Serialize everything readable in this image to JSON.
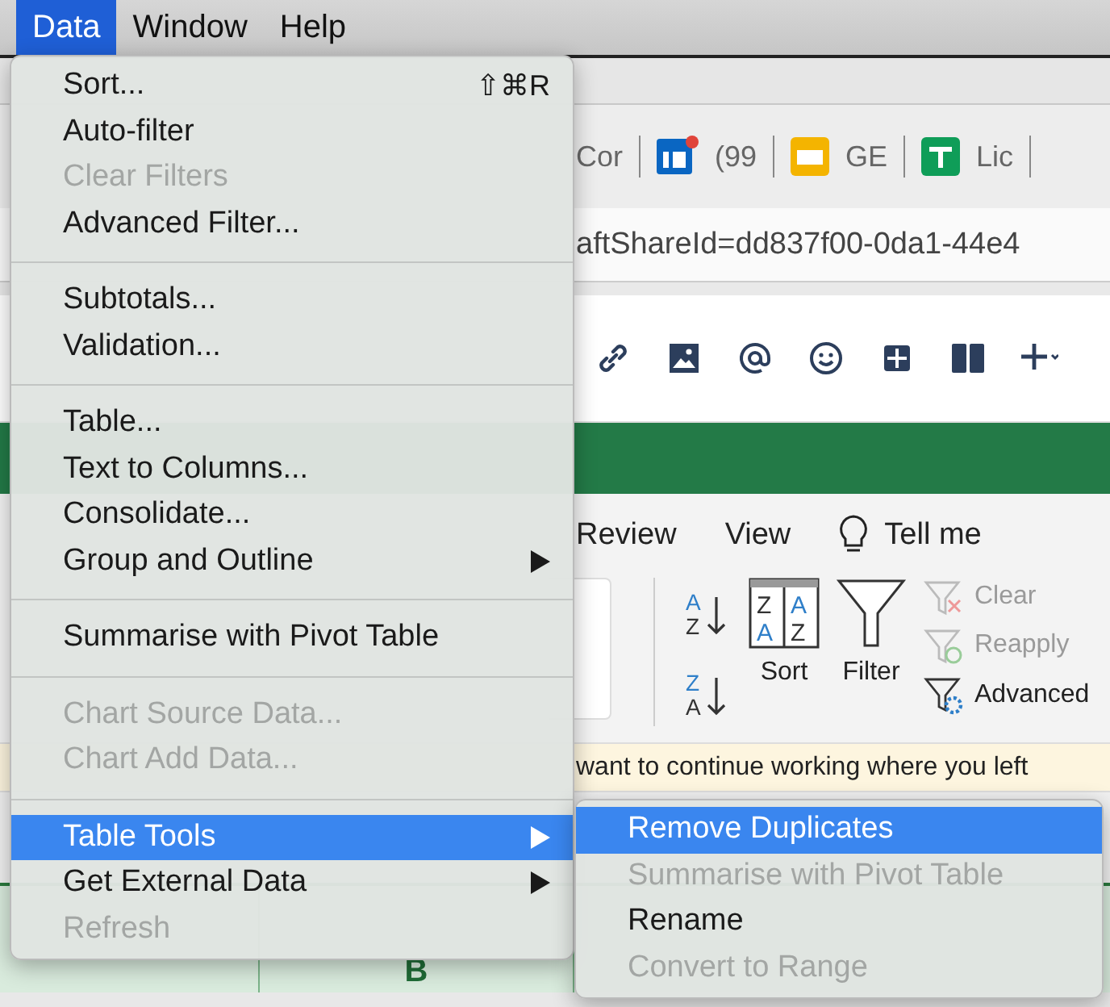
{
  "menubar": [
    {
      "label": "Data",
      "selected": true
    },
    {
      "label": "Window",
      "selected": false
    },
    {
      "label": "Help",
      "selected": false
    }
  ],
  "browser": {
    "bookmarks": [
      {
        "label": "Cor",
        "kind": "plain"
      },
      {
        "label": "(99",
        "kind": "profile"
      },
      {
        "label": "GE",
        "kind": "slides"
      },
      {
        "label": "Lic",
        "kind": "sheet"
      }
    ],
    "address": "aftShareId=dd837f00-0da1-44e4"
  },
  "ribbon": {
    "tabs": [
      {
        "label": "Review",
        "kind": "tab"
      },
      {
        "label": "View",
        "kind": "tab"
      },
      {
        "label": "Tell me",
        "kind": "search"
      }
    ],
    "sort_icons": [
      {
        "letters": [
          "A",
          "Z"
        ]
      },
      {
        "letters": [
          "Z",
          "A"
        ]
      }
    ],
    "sort_dialog_letters": [
      "Z",
      "A",
      "A",
      "Z"
    ],
    "sort_label": "Sort",
    "filter_label": "Filter",
    "filter_actions": [
      {
        "label": "Clear",
        "disabled": true,
        "kind": "clear"
      },
      {
        "label": "Reapply",
        "disabled": true,
        "kind": "reapply"
      },
      {
        "label": "Advanced",
        "disabled": false,
        "kind": "advanced"
      }
    ]
  },
  "notification": "want to continue working where you left",
  "sheet": {
    "column_header": "B"
  },
  "menu": {
    "items": [
      {
        "kind": "item",
        "label": "Sort...",
        "shortcut": "⇧⌘R",
        "disabled": false,
        "selected": false,
        "submenu": false
      },
      {
        "kind": "item",
        "label": "Auto-filter",
        "disabled": false,
        "selected": false,
        "submenu": false
      },
      {
        "kind": "item",
        "label": "Clear Filters",
        "disabled": true,
        "selected": false,
        "submenu": false
      },
      {
        "kind": "item",
        "label": "Advanced Filter...",
        "disabled": false,
        "selected": false,
        "submenu": false
      },
      {
        "kind": "separator"
      },
      {
        "kind": "item",
        "label": "Subtotals...",
        "disabled": false,
        "selected": false,
        "submenu": false
      },
      {
        "kind": "item",
        "label": "Validation...",
        "disabled": false,
        "selected": false,
        "submenu": false
      },
      {
        "kind": "separator"
      },
      {
        "kind": "item",
        "label": "Table...",
        "disabled": false,
        "selected": false,
        "submenu": false
      },
      {
        "kind": "item",
        "label": "Text to Columns...",
        "disabled": false,
        "selected": false,
        "submenu": false
      },
      {
        "kind": "item",
        "label": "Consolidate...",
        "disabled": false,
        "selected": false,
        "submenu": false
      },
      {
        "kind": "item",
        "label": "Group and Outline",
        "disabled": false,
        "selected": false,
        "submenu": true
      },
      {
        "kind": "separator"
      },
      {
        "kind": "item",
        "label": "Summarise with Pivot Table",
        "disabled": false,
        "selected": false,
        "submenu": false
      },
      {
        "kind": "separator"
      },
      {
        "kind": "item",
        "label": "Chart Source Data...",
        "disabled": true,
        "selected": false,
        "submenu": false
      },
      {
        "kind": "item",
        "label": "Chart Add Data...",
        "disabled": true,
        "selected": false,
        "submenu": false
      },
      {
        "kind": "separator"
      },
      {
        "kind": "item",
        "label": "Table Tools",
        "disabled": false,
        "selected": true,
        "submenu": true
      },
      {
        "kind": "item",
        "label": "Get External Data",
        "disabled": false,
        "selected": false,
        "submenu": true
      },
      {
        "kind": "item",
        "label": "Refresh",
        "disabled": true,
        "selected": false,
        "submenu": false
      }
    ]
  },
  "submenu": {
    "items": [
      {
        "kind": "item",
        "label": "Remove Duplicates",
        "disabled": false,
        "selected": true,
        "submenu": false
      },
      {
        "kind": "item",
        "label": "Summarise with Pivot Table",
        "disabled": true,
        "selected": false,
        "submenu": false
      },
      {
        "kind": "item",
        "label": "Rename",
        "disabled": false,
        "selected": false,
        "submenu": false
      },
      {
        "kind": "item",
        "label": "Convert to Range",
        "disabled": true,
        "selected": false,
        "submenu": false
      }
    ]
  }
}
